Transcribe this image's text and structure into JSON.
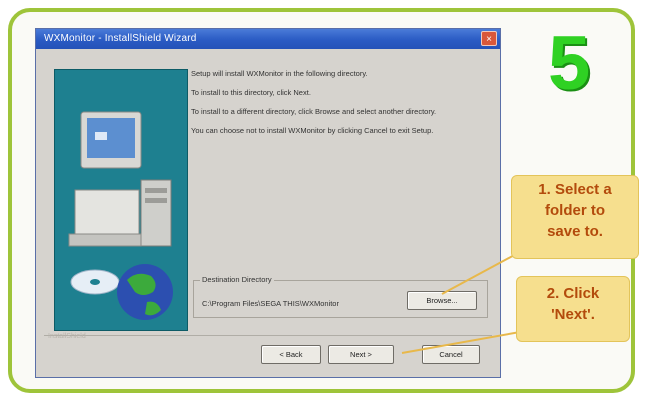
{
  "step_number": "5",
  "window": {
    "title": "WXMonitor - InstallShield Wizard",
    "close_glyph": "×"
  },
  "body": {
    "line1": "Setup will install WXMonitor in the following directory.",
    "line2": "To install to this directory, click Next.",
    "line3": "To install to a different directory, click Browse and select another directory.",
    "line4": "You can choose not to install WXMonitor by clicking Cancel to exit Setup."
  },
  "destination": {
    "label": "Destination Directory",
    "path": "C:\\Program Files\\SEGA THIS\\WXMonitor"
  },
  "buttons": {
    "browse": "Browse...",
    "back": "< Back",
    "next": "Next >",
    "cancel": "Cancel"
  },
  "brand": "InstallShield",
  "callouts": {
    "first": [
      "1. Select a",
      "folder to",
      "save to."
    ],
    "second": [
      "2. Click",
      "'Next'."
    ]
  },
  "colors": {
    "frame_border": "#9ec43a",
    "step_number": "#2fd123",
    "callout_bg": "#f6df8e",
    "callout_text": "#b34b0c",
    "side_art": "#1e8090"
  }
}
